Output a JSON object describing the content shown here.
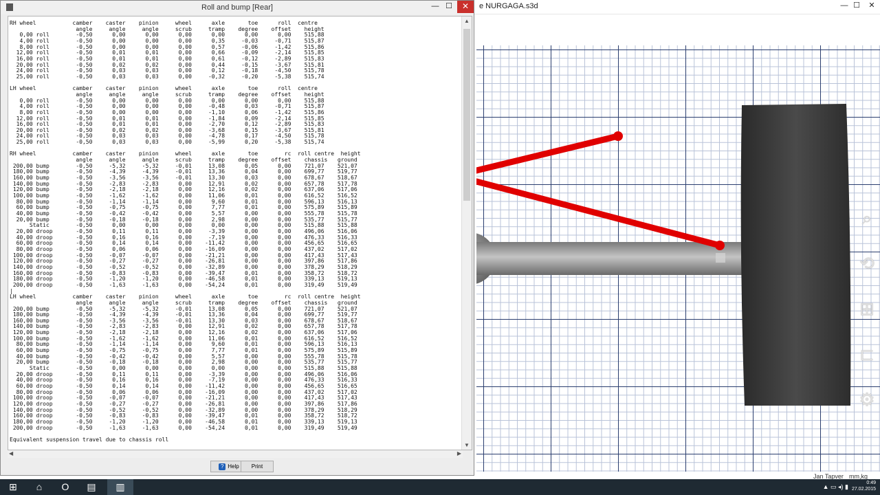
{
  "background_app": {
    "title": "e NURGAGA.s3d",
    "status_user": "Jan Tapver",
    "status_units": "mm,kg",
    "side_icons": [
      "magnifier-icon",
      "settings-icon",
      "windows-start-icon",
      "devices-icon",
      "gear-icon"
    ]
  },
  "dialog": {
    "title": "Roll and bump [Rear]",
    "close_glyph": "✕",
    "report": "RH wheel           camber    caster    pinion     wheel      axle       toe      roll  centre\n                    angle     angle     angle     scrub     tramp    degree    offset    height\n   0,00 roll        -0,50      0,00      0,00      0,00      0,00      0,00      0,00    515,88\n   4,00 roll        -0,50      0,00      0,00      0,00      0,35     -0,03     -0,71    515,87\n   8,00 roll        -0,50      0,00      0,00      0,00      0,57     -0,06     -1,42    515,86\n  12,00 roll        -0,50      0,01      0,01      0,00      0,66     -0,09     -2,14    515,85\n  16,00 roll        -0,50      0,01      0,01      0,00      0,61     -0,12     -2,89    515,83\n  20,00 roll        -0,50      0,02      0,02      0,00      0,44     -0,15     -3,67    515,81\n  24,00 roll        -0,50      0,03      0,03      0,00      0,12     -0,18     -4,50    515,78\n  25,00 roll        -0,50      0,03      0,03      0,00     -0,32     -0,20     -5,38    515,74\n\nLH wheel           camber    caster    pinion     wheel      axle       toe      roll  centre\n                    angle     angle     angle     scrub     tramp    degree    offset    height\n   0,00 roll        -0,50      0,00      0,00      0,00      0,00      0,00      0,00    515,88\n   4,00 roll        -0,50      0,00      0,00      0,00     -0,48      0,03     -0,71    515,87\n   8,00 roll        -0,50      0,00      0,00      0,00     -1,10      0,06     -1,42    515,86\n  12,00 roll        -0,50      0,01      0,01      0,00     -1,84      0,09     -2,14    515,85\n  16,00 roll        -0,50      0,01      0,01      0,00     -2,70      0,12     -2,89    515,83\n  20,00 roll        -0,50      0,02      0,02      0,00     -3,68      0,15     -3,67    515,81\n  24,00 roll        -0,50      0,03      0,03      0,00     -4,78      0,17     -4,50    515,78\n  25,00 roll        -0,50      0,03      0,03      0,00     -5,99      0,20     -5,38    515,74\n\nRH wheel           camber    caster    pinion     wheel      axle       toe        rc  roll centre  height\n                    angle     angle     angle     scrub     tramp    degree    offset    chassis   ground\n 200,00 bump        -0,50     -5,32     -5,32     -0,01     13,08      0,05      0,00    721,07    521,07\n 180,00 bump        -0,50     -4,39     -4,39     -0,01     13,36      0,04      0,00    699,77    519,77\n 160,00 bump        -0,50     -3,56     -3,56     -0,01     13,30      0,03      0,00    678,67    518,67\n 140,00 bump        -0,50     -2,83     -2,83      0,00     12,91      0,02      0,00    657,78    517,78\n 120,00 bump        -0,50     -2,18     -2,18      0,00     12,16      0,02      0,00    637,06    517,06\n 100,00 bump        -0,50     -1,62     -1,62      0,00     11,06      0,01      0,00    616,52    516,52\n  80,00 bump        -0,50     -1,14     -1,14      0,00      9,60      0,01      0,00    596,13    516,13\n  60,00 bump        -0,50     -0,75     -0,75      0,00      7,77      0,01      0,00    575,89    515,89\n  40,00 bump        -0,50     -0,42     -0,42      0,00      5,57      0,00      0,00    555,78    515,78\n  20,00 bump        -0,50     -0,18     -0,18      0,00      2,98      0,00      0,00    535,77    515,77\n      Static        -0,50      0,00      0,00      0,00      0,00      0,00      0,00    515,88    515,88\n  20,00 droop       -0,50      0,11      0,11      0,00     -3,39      0,00      0,00    496,06    516,06\n  40,00 droop       -0,50      0,16      0,16      0,00     -7,19      0,00      0,00    476,33    516,33\n  60,00 droop       -0,50      0,14      0,14      0,00    -11,42      0,00      0,00    456,65    516,65\n  80,00 droop       -0,50      0,06      0,06      0,00    -16,09      0,00      0,00    437,02    517,02\n 100,00 droop       -0,50     -0,07     -0,07      0,00    -21,21      0,00      0,00    417,43    517,43\n 120,00 droop       -0,50     -0,27     -0,27      0,00    -26,81      0,00      0,00    397,86    517,86\n 140,00 droop       -0,50     -0,52     -0,52      0,00    -32,89      0,00      0,00    378,29    518,29\n 160,00 droop       -0,50     -0,83     -0,83      0,00    -39,47      0,01      0,00    358,72    518,72\n 180,00 droop       -0,50     -1,20     -1,20      0,00    -46,58      0,01      0,00    339,13    519,13\n 200,00 droop       -0,50     -1,63     -1,63      0,00    -54,24      0,01      0,00    319,49    519,49\n|\nLH wheel           camber    caster    pinion     wheel      axle       toe        rc  roll centre  height\n                    angle     angle     angle     scrub     tramp    degree    offset    chassis   ground\n 200,00 bump        -0,50     -5,32     -5,32     -0,01     13,08      0,05      0,00    721,07    521,07\n 180,00 bump        -0,50     -4,39     -4,39     -0,01     13,36      0,04      0,00    699,77    519,77\n 160,00 bump        -0,50     -3,56     -3,56     -0,01     13,30      0,03      0,00    678,67    518,67\n 140,00 bump        -0,50     -2,83     -2,83      0,00     12,91      0,02      0,00    657,78    517,78\n 120,00 bump        -0,50     -2,18     -2,18      0,00     12,16      0,02      0,00    637,06    517,06\n 100,00 bump        -0,50     -1,62     -1,62      0,00     11,06      0,01      0,00    616,52    516,52\n  80,00 bump        -0,50     -1,14     -1,14      0,00      9,60      0,01      0,00    596,13    516,13\n  60,00 bump        -0,50     -0,75     -0,75      0,00      7,77      0,01      0,00    575,89    515,89\n  40,00 bump        -0,50     -0,42     -0,42      0,00      5,57      0,00      0,00    555,78    515,78\n  20,00 bump        -0,50     -0,18     -0,18      0,00      2,98      0,00      0,00    535,77    515,77\n      Static        -0,50      0,00      0,00      0,00      0,00      0,00      0,00    515,88    515,88\n  20,00 droop       -0,50      0,11      0,11      0,00     -3,39      0,00      0,00    496,06    516,06\n  40,00 droop       -0,50      0,16      0,16      0,00     -7,19      0,00      0,00    476,33    516,33\n  60,00 droop       -0,50      0,14      0,14      0,00    -11,42      0,00      0,00    456,65    516,65\n  80,00 droop       -0,50      0,06      0,06      0,00    -16,09      0,00      0,00    437,02    517,02\n 100,00 droop       -0,50     -0,07     -0,07      0,00    -21,21      0,00      0,00    417,43    517,43\n 120,00 droop       -0,50     -0,27     -0,27      0,00    -26,81      0,00      0,00    397,86    517,86\n 140,00 droop       -0,50     -0,52     -0,52      0,00    -32,89      0,00      0,00    378,29    518,29\n 160,00 droop       -0,50     -0,83     -0,83      0,00    -39,47      0,01      0,00    358,72    518,72\n 180,00 droop       -0,50     -1,20     -1,20      0,00    -46,58      0,01      0,00    339,13    519,13\n 200,00 droop       -0,50     -1,63     -1,63      0,00    -54,24      0,01      0,00    319,49    519,49\n\nEquivalent suspension travel due to chassis roll",
    "buttons": {
      "help": "Help",
      "help_glyph": "?",
      "print": "Print"
    }
  },
  "taskbar": {
    "start_icon": "windows-start-icon",
    "apps": [
      "file-explorer-icon",
      "opera-icon",
      "folder-icon",
      "suspension-app-icon"
    ],
    "clock_time": "0:49",
    "clock_date": "27.02.2015"
  },
  "colors": {
    "arm": "#e00000",
    "wheel": "#3a3a3a",
    "grid_major": "#2a3d6e",
    "close_btn": "#c9302c",
    "taskbar": "#1f2a33"
  }
}
